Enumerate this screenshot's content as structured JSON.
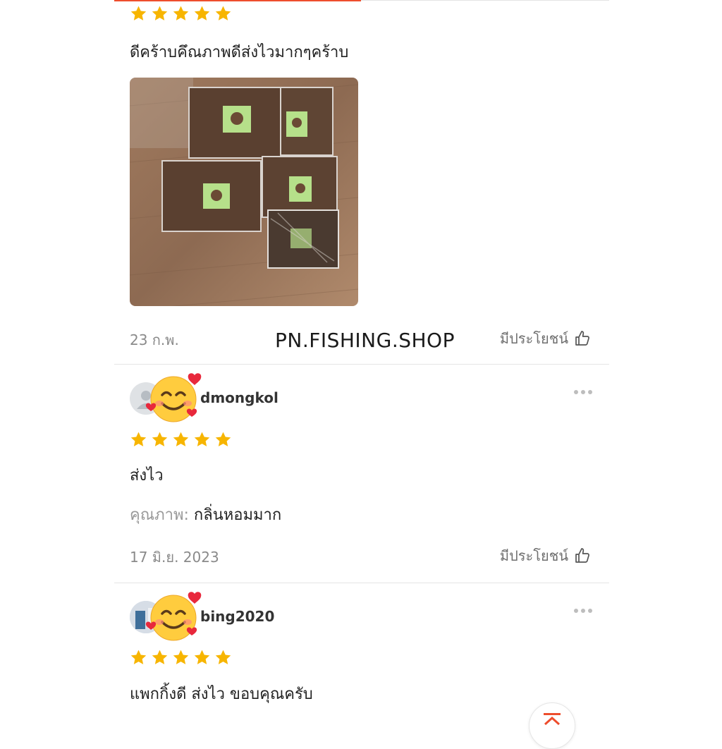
{
  "watermark": "PN.FISHING.SHOP",
  "helpful_label": "มีประโยชน์",
  "review1": {
    "stars": 5,
    "text": "ดีคร้าบคึณภาพดีส่งไวมากๆคร้าบ",
    "photo_icon": "product-photo",
    "date": "23 ก.พ."
  },
  "review2": {
    "username": "dmongkol",
    "stars": 5,
    "text": "ส่งไว",
    "quality_label": "คุณภาพ:",
    "quality_value": "กลิ่นหอมมาก",
    "date": "17 มิ.ย. 2023"
  },
  "review3": {
    "username": "bing2020",
    "stars": 5,
    "text": "แพกกิ้งดี ส่งไว ขอบคุณครับ"
  },
  "colors": {
    "star": "#f7b500",
    "accent": "#ee4d2d",
    "divider": "#e5e5e5",
    "muted": "#8a8a8a"
  },
  "icons": {
    "star": "star-icon",
    "thumbs_up": "thumbs-up-icon",
    "more": "more-icon",
    "emoji": "smiling-face-with-hearts-icon",
    "scroll_top": "scroll-to-top-icon"
  }
}
